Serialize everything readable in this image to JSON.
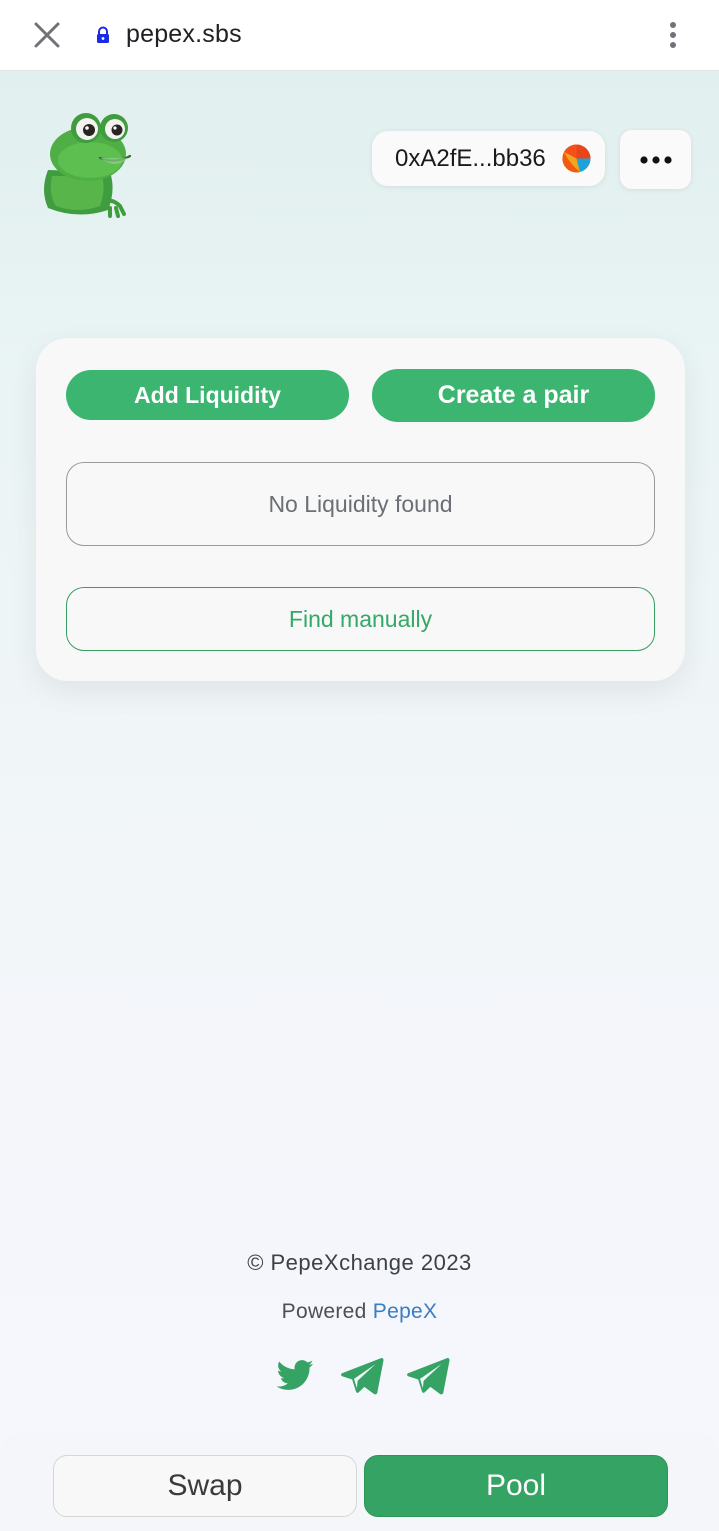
{
  "browser": {
    "url": "pepex.sbs",
    "icons": [
      "close-icon",
      "lock-icon",
      "kebab-menu-icon"
    ]
  },
  "header": {
    "logo_icon": "pepe-frog-logo",
    "wallet_address": "0xA2fE...bb36",
    "wallet_avatar_icon": "wallet-avatar-icon",
    "more_icon": "more-horizontal-icon"
  },
  "pool_card": {
    "add_liquidity_label": "Add Liquidity",
    "create_pair_label": "Create a pair",
    "empty_state": "No Liquidity found",
    "find_manually_label": "Find manually"
  },
  "footer": {
    "copyright": "© PepeXchange 2023",
    "powered_prefix": "Powered",
    "powered_link": "PepeX",
    "social_icons": [
      "twitter-icon",
      "telegram-icon",
      "telegram-icon"
    ]
  },
  "tabs": [
    {
      "label": "Swap",
      "active": false
    },
    {
      "label": "Pool",
      "active": true
    }
  ],
  "colors": {
    "accent_green": "#3cb571",
    "link_blue": "#3a7dc0",
    "lock_blue": "#1a2be8"
  }
}
